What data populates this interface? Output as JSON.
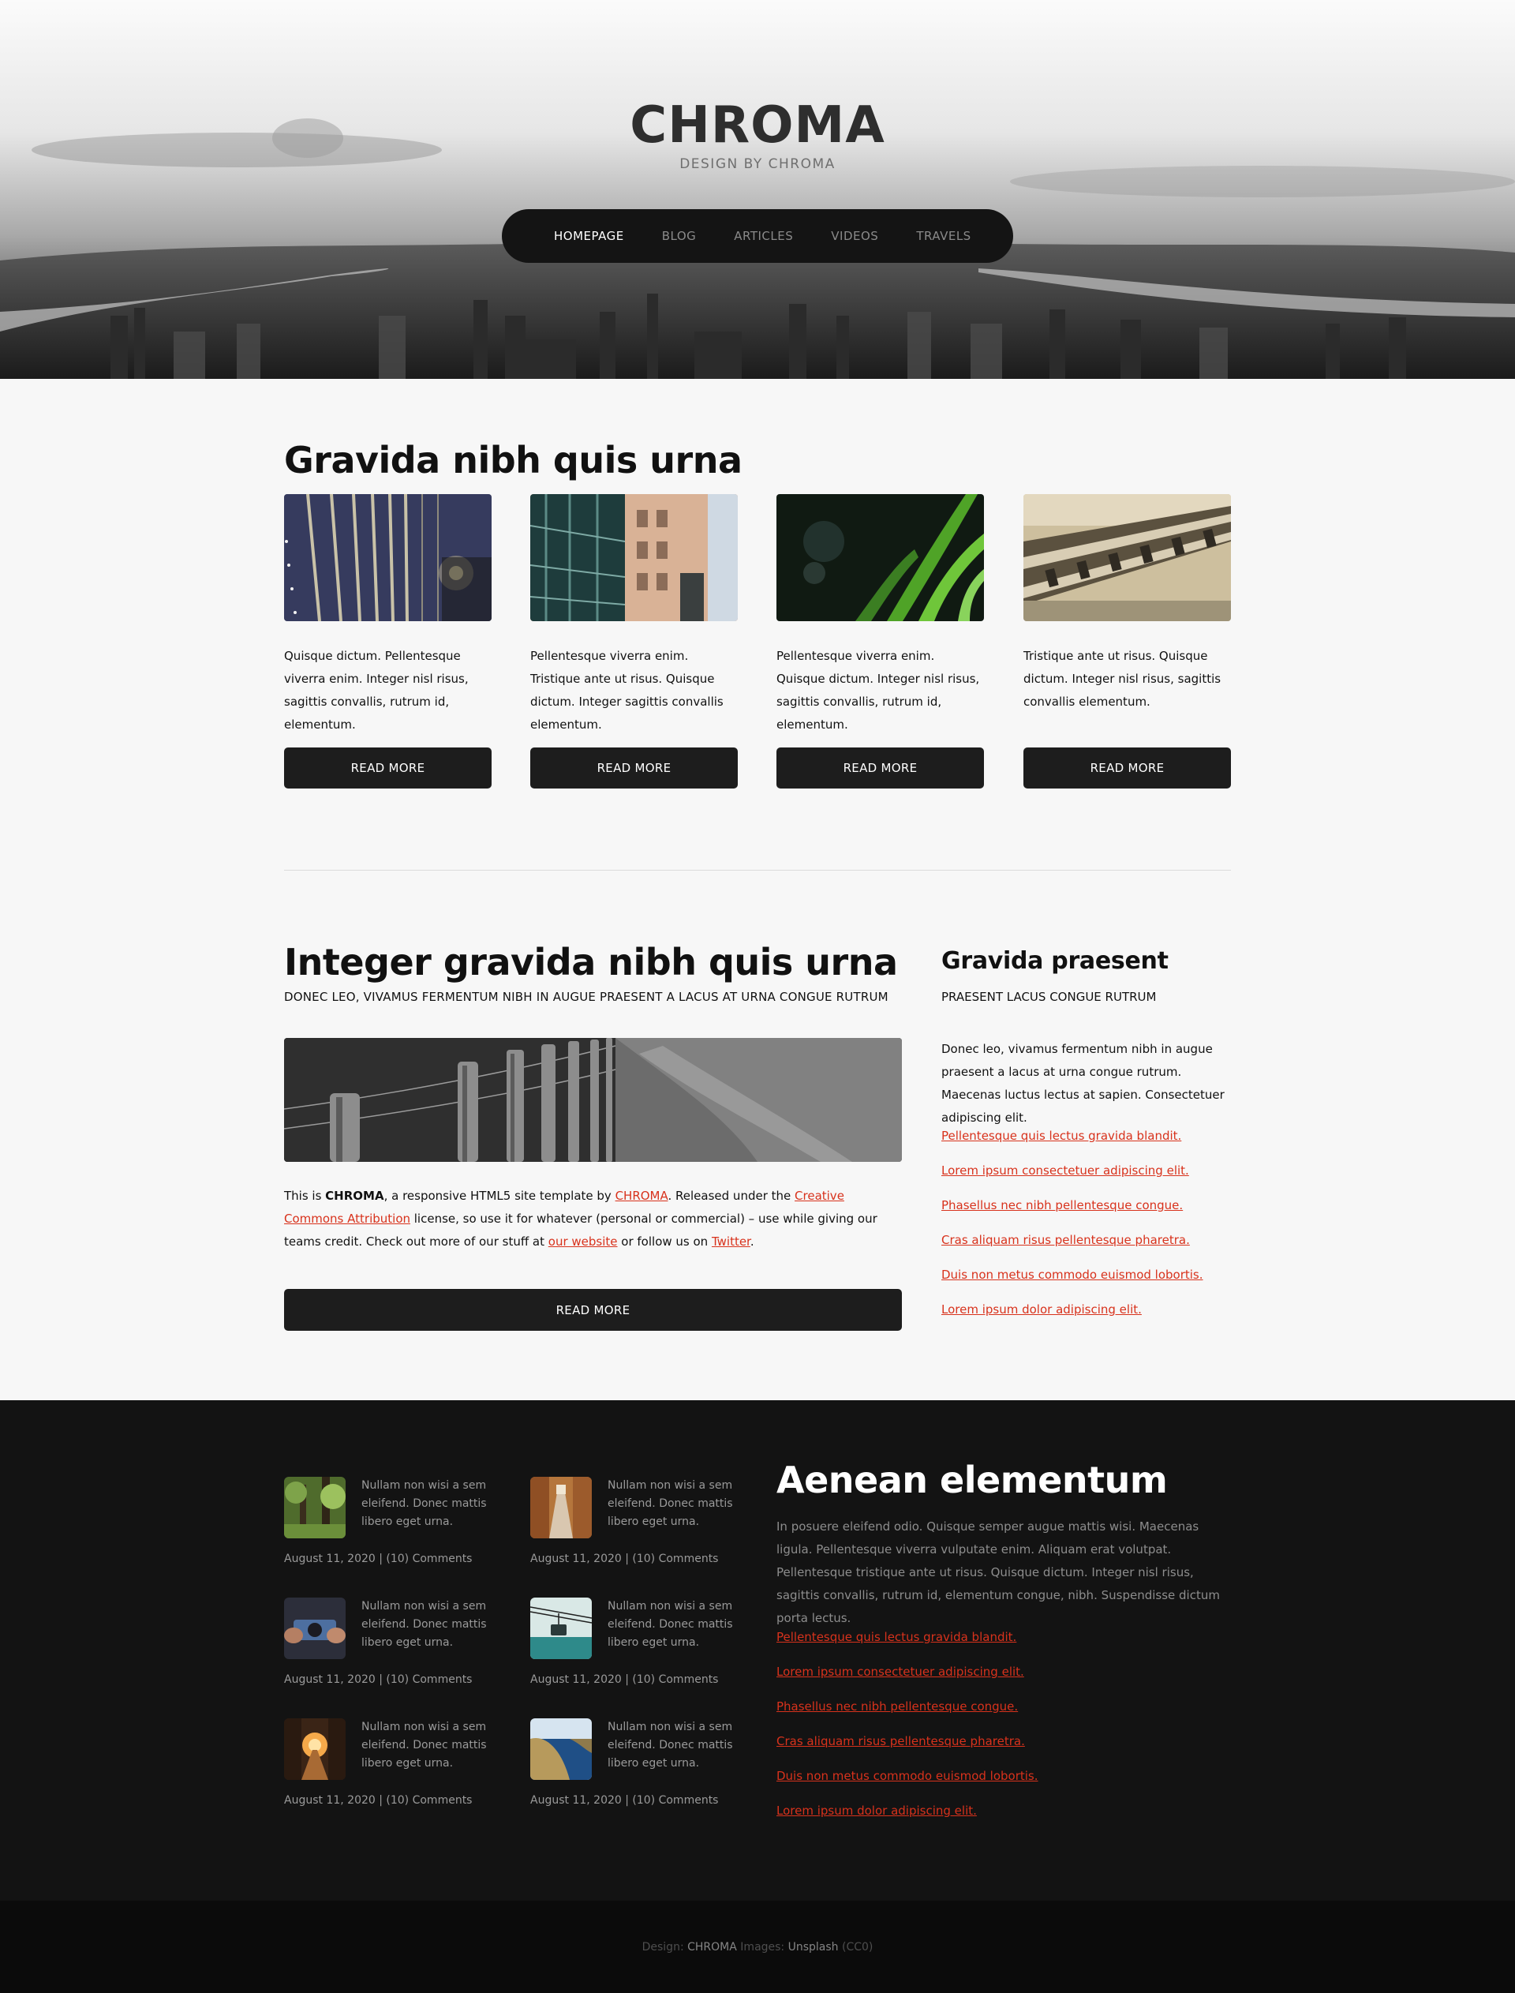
{
  "site": {
    "brand": "CHROMA",
    "tagline": "DESIGN BY CHROMA"
  },
  "nav": {
    "items": [
      "HOMEPAGE",
      "BLOG",
      "ARTICLES",
      "VIDEOS",
      "TRAVELS"
    ],
    "active": "HOMEPAGE"
  },
  "section1": {
    "title": "Gravida nibh quis urna",
    "cards": [
      {
        "text": "Quisque dictum. Pellentesque viverra enim. Integer nisl risus, sagittis convallis, rutrum id, elementum.",
        "button": "READ MORE",
        "image": "bridge-cables"
      },
      {
        "text": "Pellentesque viverra enim. Tristique ante ut risus. Quisque dictum. Integer sagittis convallis elementum.",
        "button": "READ MORE",
        "image": "city-street"
      },
      {
        "text": "Pellentesque viverra enim. Quisque dictum. Integer nisl risus, sagittis convallis, rutrum id, elementum.",
        "button": "READ MORE",
        "image": "green-grass"
      },
      {
        "text": "Tristique ante ut risus. Quisque dictum. Integer nisl risus, sagittis convallis elementum.",
        "button": "READ MORE",
        "image": "railway-track"
      }
    ]
  },
  "section2": {
    "title": "Integer gravida nibh quis urna",
    "subtitle": "DONEC LEO, VIVAMUS FERMENTUM NIBH IN AUGUE PRAESENT A LACUS AT URNA CONGUE RUTRUM",
    "paragraph": {
      "p1": "This is ",
      "brand": "CHROMA",
      "p2": ", a responsive HTML5 site template by ",
      "link1": "CHROMA",
      "p3": ". Released under the ",
      "link2": "Creative Commons Attribution",
      "p4": " license, so use it for whatever (personal or commercial) – use while giving our teams credit. Check out more of our stuff at ",
      "link3": "our website",
      "p5": " or follow us on ",
      "link4": "Twitter",
      "p6": "."
    },
    "button": "READ MORE",
    "sidebar": {
      "title": "Gravida praesent",
      "subtitle": "PRAESENT LACUS CONGUE RUTRUM",
      "paragraph": "Donec leo, vivamus fermentum nibh in augue praesent a lacus at urna congue rutrum. Maecenas luctus lectus at sapien. Consectetuer adipiscing elit.",
      "links": [
        "Pellentesque quis lectus gravida blandit.",
        "Lorem ipsum consectetuer adipiscing elit.",
        "Phasellus nec nibh pellentesque congue.",
        "Cras aliquam risus pellentesque pharetra.",
        "Duis non metus commodo euismod lobortis.",
        "Lorem ipsum dolor adipiscing elit."
      ]
    }
  },
  "footer": {
    "posts": [
      {
        "text": "Nullam non wisi a sem eleifend. Donec mattis libero eget urna.",
        "meta": "August 11, 2020 | (10) Comments",
        "image": "forest"
      },
      {
        "text": "Nullam non wisi a sem eleifend. Donec mattis libero eget urna.",
        "meta": "August 11, 2020 | (10) Comments",
        "image": "alley"
      },
      {
        "text": "Nullam non wisi a sem eleifend. Donec mattis libero eget urna.",
        "meta": "August 11, 2020 | (10) Comments",
        "image": "hands-camera"
      },
      {
        "text": "Nullam non wisi a sem eleifend. Donec mattis libero eget urna.",
        "meta": "August 11, 2020 | (10) Comments",
        "image": "cable-car"
      },
      {
        "text": "Nullam non wisi a sem eleifend. Donec mattis libero eget urna.",
        "meta": "August 11, 2020 | (10) Comments",
        "image": "sunset-street"
      },
      {
        "text": "Nullam non wisi a sem eleifend. Donec mattis libero eget urna.",
        "meta": "August 11, 2020 | (10) Comments",
        "image": "coastline"
      }
    ],
    "title": "Aenean elementum",
    "paragraph": "In posuere eleifend odio. Quisque semper augue mattis wisi. Maecenas ligula. Pellentesque viverra vulputate enim. Aliquam erat volutpat. Pellentesque tristique ante ut risus. Quisque dictum. Integer nisl risus, sagittis convallis, rutrum id, elementum congue, nibh. Suspendisse dictum porta lectus.",
    "links": [
      "Pellentesque quis lectus gravida blandit.",
      "Lorem ipsum consectetuer adipiscing elit.",
      "Phasellus nec nibh pellentesque congue.",
      "Cras aliquam risus pellentesque pharetra.",
      "Duis non metus commodo euismod lobortis.",
      "Lorem ipsum dolor adipiscing elit."
    ]
  },
  "credits": {
    "design_label": "Design:",
    "design_value": "CHROMA",
    "images_label": "Images:",
    "images_value": "Unsplash",
    "license": "(CC0)"
  },
  "colors": {
    "link": "#d8321c",
    "button": "#1d1d1d",
    "nav_bg": "#141414",
    "dark_bg": "#131313",
    "bottom_bg": "#0b0b0b"
  }
}
